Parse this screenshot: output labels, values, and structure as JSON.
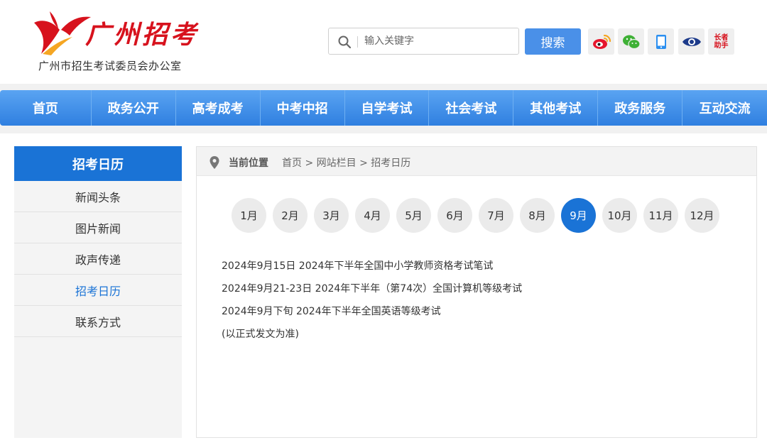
{
  "header": {
    "logo_title": "广州招考",
    "logo_subtitle": "广州市招生考试委员会办公室",
    "search_placeholder": "输入关键字",
    "search_button": "搜索",
    "tools": [
      {
        "icon": "weibo-icon"
      },
      {
        "icon": "wechat-icon"
      },
      {
        "icon": "mobile-icon"
      },
      {
        "icon": "eye-icon"
      },
      {
        "icon": "elder-helper-icon",
        "label": "长者助手"
      }
    ]
  },
  "nav": {
    "items": [
      "首页",
      "政务公开",
      "高考成考",
      "中考中招",
      "自学考试",
      "社会考试",
      "其他考试",
      "政务服务",
      "互动交流"
    ]
  },
  "sidebar": {
    "title": "招考日历",
    "items": [
      {
        "label": "新闻头条"
      },
      {
        "label": "图片新闻"
      },
      {
        "label": "政声传递"
      },
      {
        "label": "招考日历"
      },
      {
        "label": "联系方式"
      }
    ],
    "active_index": 3
  },
  "breadcrumb": {
    "label": "当前位置",
    "path": "首页 > 网站栏目 > 招考日历"
  },
  "calendar": {
    "months": [
      "1月",
      "2月",
      "3月",
      "4月",
      "5月",
      "6月",
      "7月",
      "8月",
      "9月",
      "10月",
      "11月",
      "12月"
    ],
    "active_month": "9月",
    "events": [
      "2024年9月15日 2024年下半年全国中小学教师资格考试笔试",
      "2024年9月21-23日 2024年下半年（第74次）全国计算机等级考试",
      "2024年9月下旬 2024年下半年全国英语等级考试",
      "(以正式发文为准)"
    ]
  },
  "colors": {
    "brand_red": "#d7121d",
    "accent_blue": "#1a73d6",
    "nav_blue": "#3b87e4"
  }
}
